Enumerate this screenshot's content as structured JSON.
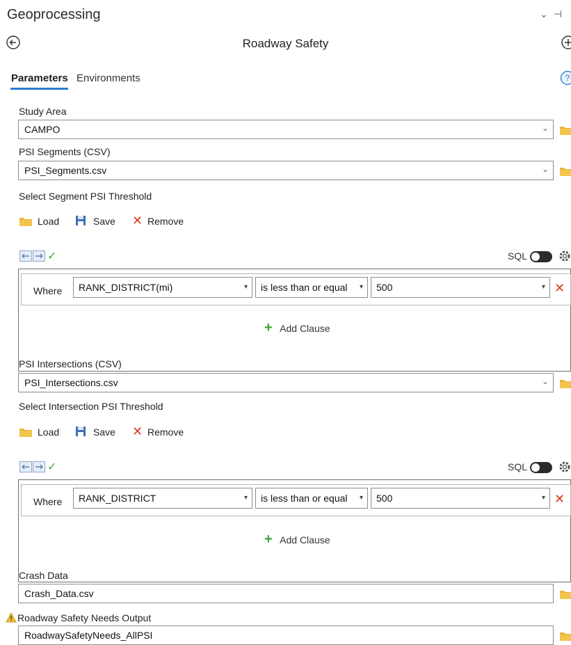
{
  "pane": {
    "title": "Geoprocessing",
    "controls": [
      "⌄",
      "⊣"
    ],
    "tool_name": "Roadway Safety"
  },
  "tabs": [
    {
      "label": "Parameters",
      "active": true
    },
    {
      "label": "Environments",
      "active": false
    }
  ],
  "params": {
    "study_area": {
      "label": "Study Area",
      "value": "CAMPO"
    },
    "psi_segments": {
      "label": "PSI Segments (CSV)",
      "value": "PSI_Segments.csv"
    },
    "segment_threshold": {
      "label": "Select Segment PSI Threshold",
      "load": "Load",
      "save": "Save",
      "remove": "Remove",
      "sql": "SQL",
      "clause": {
        "where": "Where",
        "field": "RANK_DISTRICT(mi)",
        "operator": "is less than or equal",
        "value": "500"
      },
      "add_clause": "Add Clause"
    },
    "psi_intersections": {
      "label": "PSI Intersections (CSV)",
      "value": "PSI_Intersections.csv"
    },
    "intersection_threshold": {
      "label": "Select Intersection PSI Threshold",
      "load": "Load",
      "save": "Save",
      "remove": "Remove",
      "sql": "SQL",
      "clause": {
        "where": "Where",
        "field": "RANK_DISTRICT",
        "operator": "is less than or equal",
        "value": "500"
      },
      "add_clause": "Add Clause"
    },
    "crash_data": {
      "label": "Crash Data",
      "value": "Crash_Data.csv"
    },
    "output": {
      "label": "Roadway Safety Needs Output",
      "value": "RoadwaySafetyNeeds_AllPSI"
    }
  },
  "colors": {
    "accent": "#2a7bd6",
    "folder": "#e8b53a",
    "remove": "#d93a1a",
    "check": "#3aa83a"
  }
}
